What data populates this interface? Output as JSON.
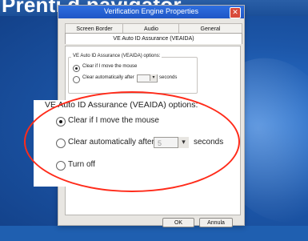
{
  "header": {
    "title": "Prenti d navigator"
  },
  "window": {
    "title": "Verification Engine Properties",
    "close_glyph": "✕"
  },
  "tabs": [
    {
      "label": "Screen Border"
    },
    {
      "label": "Audio"
    },
    {
      "label": "General"
    },
    {
      "label": "VE Auto ID Assurance (VEAIDA)",
      "active": true
    }
  ],
  "options_small": {
    "legend": "VE Auto ID Assurance (VEAIDA) options:",
    "option_clear_mouse": "Clear if I move the mouse",
    "option_clear_after": "Clear automatically after",
    "seconds_label": "seconds",
    "selected": "Clear if I move the mouse"
  },
  "options_zoom": {
    "legend": "VE Auto ID Assurance (VEAIDA) options:",
    "option_clear_mouse": "Clear if I move the mouse",
    "option_clear_after": "Clear automatically after",
    "seconds_value": "5",
    "seconds_label": "seconds",
    "option_turn_off": "Turn off",
    "selected": "Clear if I move the mouse"
  },
  "buttons": {
    "ok": "OK",
    "cancel": "Annula"
  },
  "colors": {
    "highlight_oval": "#ff2b1a",
    "titlebar": "#1f56c6",
    "window_bg": "#e8e6e2",
    "desktop": "#1f5fb0"
  },
  "icons": {
    "dropdown": "chevron-down-icon"
  }
}
